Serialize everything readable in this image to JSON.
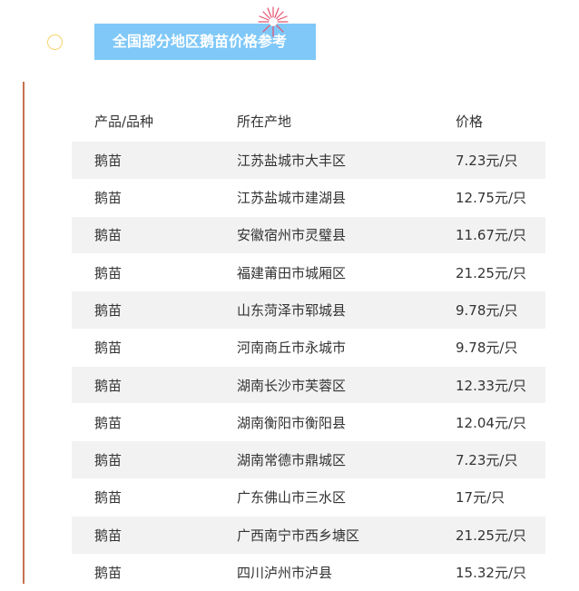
{
  "header": {
    "title": "全国部分地区鹅苗价格参考"
  },
  "table": {
    "columns": [
      "产品/品种",
      "所在产地",
      "价格"
    ],
    "rows": [
      [
        "鹅苗",
        "江苏盐城市大丰区",
        "7.23元/只"
      ],
      [
        "鹅苗",
        "江苏盐城市建湖县",
        "12.75元/只"
      ],
      [
        "鹅苗",
        "安徽宿州市灵璧县",
        "11.67元/只"
      ],
      [
        "鹅苗",
        "福建莆田市城厢区",
        "21.25元/只"
      ],
      [
        "鹅苗",
        "山东菏泽市郓城县",
        "9.78元/只"
      ],
      [
        "鹅苗",
        "河南商丘市永城市",
        "9.78元/只"
      ],
      [
        "鹅苗",
        "湖南长沙市芙蓉区",
        "12.33元/只"
      ],
      [
        "鹅苗",
        "湖南衡阳市衡阳县",
        "12.04元/只"
      ],
      [
        "鹅苗",
        "湖南常德市鼎城区",
        "7.23元/只"
      ],
      [
        "鹅苗",
        "广东佛山市三水区",
        "17元/只"
      ],
      [
        "鹅苗",
        "广西南宁市西乡塘区",
        "21.25元/只"
      ],
      [
        "鹅苗",
        "四川泸州市泸县",
        "15.32元/只"
      ]
    ]
  },
  "colors": {
    "banner": "#7fc8f8",
    "row_shade": "#f2f2f2",
    "left_rule": "#c87050",
    "circle": "#f5d36b",
    "firework": "#e8506e"
  }
}
